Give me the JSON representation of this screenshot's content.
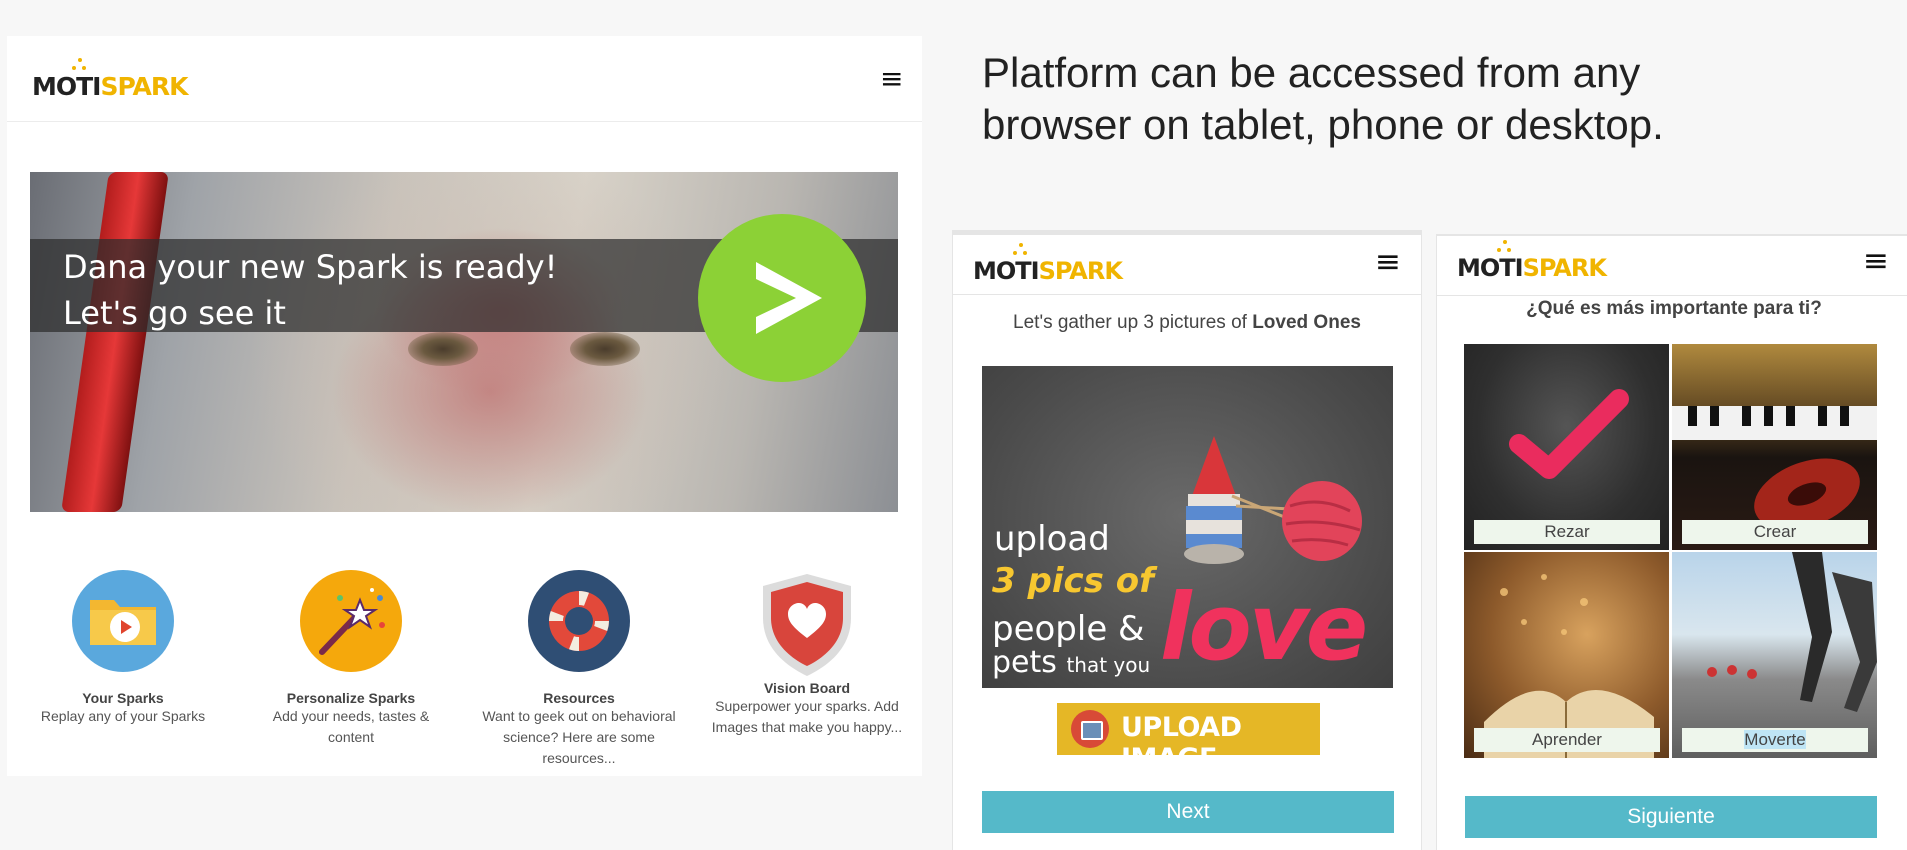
{
  "headline": {
    "line1": "Platform can be accessed from any",
    "line2": "browser on tablet, phone or desktop."
  },
  "brand": {
    "logo_part1": "MOTI",
    "logo_part2": "SPARK",
    "accent": "#f0b400"
  },
  "menu_glyph": "≡",
  "desktop": {
    "hero": {
      "message": "Dana your new Spark is ready! Let's go see it",
      "play_color": "#8cd136"
    },
    "features": [
      {
        "title": "Your Sparks",
        "desc": "Replay any of your Sparks",
        "icon": "folder-play-icon"
      },
      {
        "title": "Personalize Sparks",
        "desc": "Add your needs, tastes & content",
        "icon": "magic-wand-icon"
      },
      {
        "title": "Resources",
        "desc": "Want to geek out on behavioral science? Here are some resources...",
        "icon": "lifebuoy-icon"
      },
      {
        "title": "Vision Board",
        "desc": "Superpower your sparks. Add Images that make you happy...",
        "icon": "heart-shield-icon"
      }
    ]
  },
  "phone1": {
    "prompt_prefix": "Let's gather up 3 pictures of ",
    "prompt_bold": "Loved Ones",
    "image_text": {
      "line1": "upload",
      "line2": "3 pics of",
      "line3": "people &",
      "line4a": "pets",
      "line4b": "that you",
      "love": "love"
    },
    "upload_label": "UPLOAD IMAGE",
    "next_label": "Next"
  },
  "phone2": {
    "prompt": "¿Qué es más importante para ti?",
    "tiles": [
      {
        "label": "Rezar"
      },
      {
        "label": "Crear"
      },
      {
        "label": "Aprender"
      },
      {
        "label": "Moverte"
      }
    ],
    "next_label": "Siguiente",
    "cta_color": "#55b9c9"
  }
}
